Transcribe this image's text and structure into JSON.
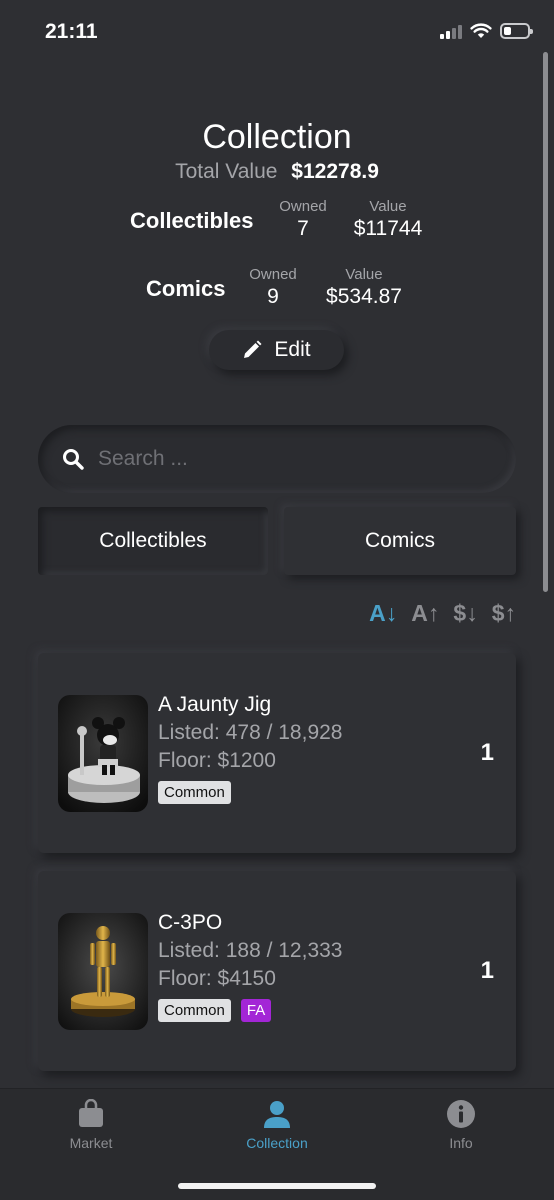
{
  "status_bar": {
    "time": "21:11"
  },
  "header": {
    "title": "Collection",
    "total_label": "Total Value",
    "total_value": "$12278.9"
  },
  "stats": {
    "collectibles": {
      "name": "Collectibles",
      "owned_label": "Owned",
      "owned": "7",
      "value_label": "Value",
      "value": "$11744"
    },
    "comics": {
      "name": "Comics",
      "owned_label": "Owned",
      "owned": "9",
      "value_label": "Value",
      "value": "$534.87"
    }
  },
  "edit_button": {
    "label": "Edit"
  },
  "search": {
    "placeholder": "Search ..."
  },
  "tabs": [
    {
      "label": "Collectibles",
      "active": true
    },
    {
      "label": "Comics",
      "active": false
    }
  ],
  "sort": [
    "A↓",
    "A↑",
    "$↓",
    "$↑"
  ],
  "items": [
    {
      "name": "A Jaunty Jig",
      "listed": "Listed: 478 / 18,928",
      "floor": "Floor: $1200",
      "rarity": "Common",
      "count": "1"
    },
    {
      "name": "C-3PO",
      "listed": "Listed: 188 / 12,333",
      "floor": "Floor: $4150",
      "rarity": "Common",
      "extra_badge": "FA",
      "count": "1"
    }
  ],
  "nav": [
    {
      "label": "Market",
      "icon": "bag-icon",
      "active": false
    },
    {
      "label": "Collection",
      "icon": "person-icon",
      "active": true
    },
    {
      "label": "Info",
      "icon": "info-icon",
      "active": false
    }
  ],
  "colors": {
    "background": "#2e2f33",
    "accent": "#4aa0c8",
    "fa_badge": "#a326d6"
  }
}
